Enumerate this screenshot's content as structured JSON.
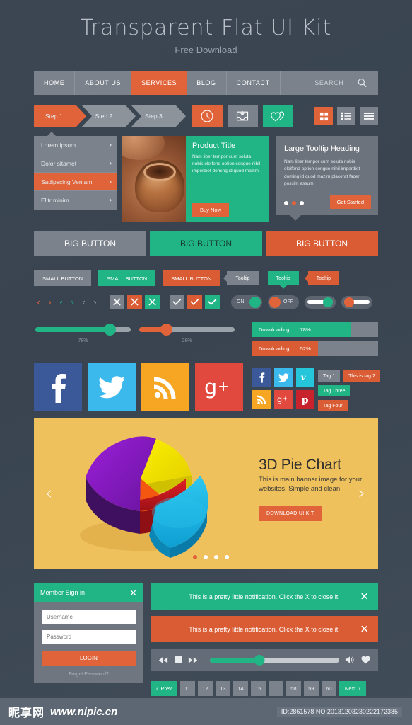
{
  "hero": {
    "title": "Transparent Flat UI Kit",
    "subtitle": "Free Download"
  },
  "nav": {
    "items": [
      "HOME",
      "ABOUT US",
      "SERVICES",
      "BLOG",
      "CONTACT"
    ],
    "active_index": 2,
    "search_placeholder": "SEARCH",
    "search_icon": "search-icon"
  },
  "steps": {
    "items": [
      "Step 1",
      "Step 2",
      "Step 3"
    ],
    "active_index": 0
  },
  "icon_buttons": [
    {
      "name": "clock-icon",
      "color": "#e0633a"
    },
    {
      "name": "inbox-download-icon",
      "color": "#7b828c"
    },
    {
      "name": "two-hearts-icon",
      "color": "#21b484"
    }
  ],
  "view_buttons": [
    {
      "name": "grid-view-icon",
      "color": "#e0633a"
    },
    {
      "name": "list-view-icon",
      "color": "#7b828c"
    },
    {
      "name": "menu-lines-icon",
      "color": "#7b828c"
    }
  ],
  "accordion": {
    "items": [
      "Lorem ipsum",
      "Dolor sitamet",
      "Sadipscing Veniam",
      "Elitr minim"
    ],
    "active_index": 2
  },
  "product": {
    "title": "Product Title",
    "text": "Nam liber tempor cum soluta nobis eleifend option congue nihil imperdiet doming id quod mazim.",
    "button": "Buy Now"
  },
  "tooltip_card": {
    "heading": "Large Tooltip Heading",
    "text": "Nam liber tempor cum soluta nobis eleifend option congue nihil imperdiet doming id quod mazim placerat facer possim assum.",
    "button": "Get Started",
    "dots": 3,
    "active_dot": 1
  },
  "big_buttons": [
    {
      "label": "BIG BUTTON",
      "color": "#7b828c"
    },
    {
      "label": "BIG BUTTON",
      "color": "#21b484"
    },
    {
      "label": "BIG BUTTON",
      "color": "#d95c34"
    }
  ],
  "small_buttons": [
    {
      "label": "SMALL BUTTON",
      "color": "#7b828c"
    },
    {
      "label": "SMALL BUTTON",
      "color": "#21b484"
    },
    {
      "label": "SMALL BUTTON",
      "color": "#d95c34"
    }
  ],
  "tooltips": [
    {
      "label": "Tooltip",
      "color": "#7b828c"
    },
    {
      "label": "Tooltip",
      "color": "#21b484"
    },
    {
      "label": "Tooltip",
      "color": "#d95c34"
    }
  ],
  "toggles": [
    {
      "label": "ON",
      "state": "on",
      "knob_color": "#21b484"
    },
    {
      "label": "OFF",
      "state": "off",
      "knob_color": "#e0633a"
    }
  ],
  "sliders": [
    {
      "value": "78%",
      "fill": 78,
      "color": "#21b484"
    },
    {
      "value": "28%",
      "fill": 28,
      "color": "#e0633a"
    }
  ],
  "downloads": [
    {
      "label": "Downloading...",
      "percent": "78%",
      "fill": 78,
      "color": "#21b484"
    },
    {
      "label": "Downloading...",
      "percent": "52%",
      "fill": 52,
      "color": "#d95c34"
    }
  ],
  "socials_large": [
    {
      "name": "facebook-icon",
      "glyph": "f",
      "color": "#3b5998"
    },
    {
      "name": "twitter-icon",
      "glyph": "t",
      "color": "#3bb9ec"
    },
    {
      "name": "rss-icon",
      "glyph": "rss",
      "color": "#f6a623"
    },
    {
      "name": "google-plus-icon",
      "glyph": "g+",
      "color": "#e2493e"
    }
  ],
  "socials_small": [
    {
      "name": "facebook-icon",
      "glyph": "f",
      "color": "#3b5998"
    },
    {
      "name": "twitter-icon",
      "glyph": "t",
      "color": "#3bb9ec"
    },
    {
      "name": "vimeo-icon",
      "glyph": "v",
      "color": "#25c6da"
    },
    {
      "name": "rss-icon",
      "glyph": "rss",
      "color": "#f6a623"
    },
    {
      "name": "google-plus-icon",
      "glyph": "g+",
      "color": "#e2493e"
    },
    {
      "name": "pinterest-icon",
      "glyph": "p",
      "color": "#c8232c"
    }
  ],
  "tags": [
    {
      "label": "Tag 1",
      "color": "#7b828c"
    },
    {
      "label": "This is tag 2",
      "color": "#d95c34"
    },
    {
      "label": "Tag Three",
      "color": "#21b484"
    },
    {
      "label": "Tag Four",
      "color": "#d95c34"
    }
  ],
  "banner": {
    "heading": "3D Pie Chart",
    "text": "This is main banner image for your websites. Simple and clean",
    "button": "DOWNLOAD UI KIT",
    "prev_icon": "chevron-left-icon",
    "next_icon": "chevron-right-icon",
    "dots": 4,
    "active_dot": 0,
    "bg_color": "#efc15c"
  },
  "login": {
    "title": "Member Sign in",
    "close_icon": "close-icon",
    "username_placeholder": "Username",
    "password_placeholder": "Password",
    "submit": "LOGIN",
    "forget": "Forget Password?"
  },
  "notifications": [
    {
      "text": "This is a pretty little notification. Click the X to close it.",
      "color": "#21b484"
    },
    {
      "text": "This is a pretty little notification. Click the X to close it.",
      "color": "#d95c34"
    }
  ],
  "player": {
    "controls": [
      "rewind-icon",
      "stop-icon",
      "forward-icon"
    ],
    "progress": 38,
    "volume_icon": "volume-icon",
    "favorite_icon": "heart-icon"
  },
  "pagination": {
    "prev": "Prev",
    "next": "Next",
    "pages": [
      "11",
      "12",
      "13",
      "14",
      "15",
      ".....",
      "58",
      "59",
      "60"
    ]
  },
  "footer": {
    "watermark_cn": "昵享网",
    "watermark_url": "www.nipic.cn",
    "id_text": "ID:2861578 NO:20131203230222172385"
  },
  "chart_data": {
    "type": "pie",
    "title": "3D Pie Chart",
    "categories": [
      "Yellow",
      "Cyan",
      "Red",
      "Purple",
      "Orange"
    ],
    "values": [
      22,
      28,
      20,
      22,
      8
    ],
    "colors": [
      "#f5e400",
      "#1cb8e8",
      "#c81f24",
      "#7a1fb5",
      "#f24f13"
    ],
    "legend": "none"
  }
}
